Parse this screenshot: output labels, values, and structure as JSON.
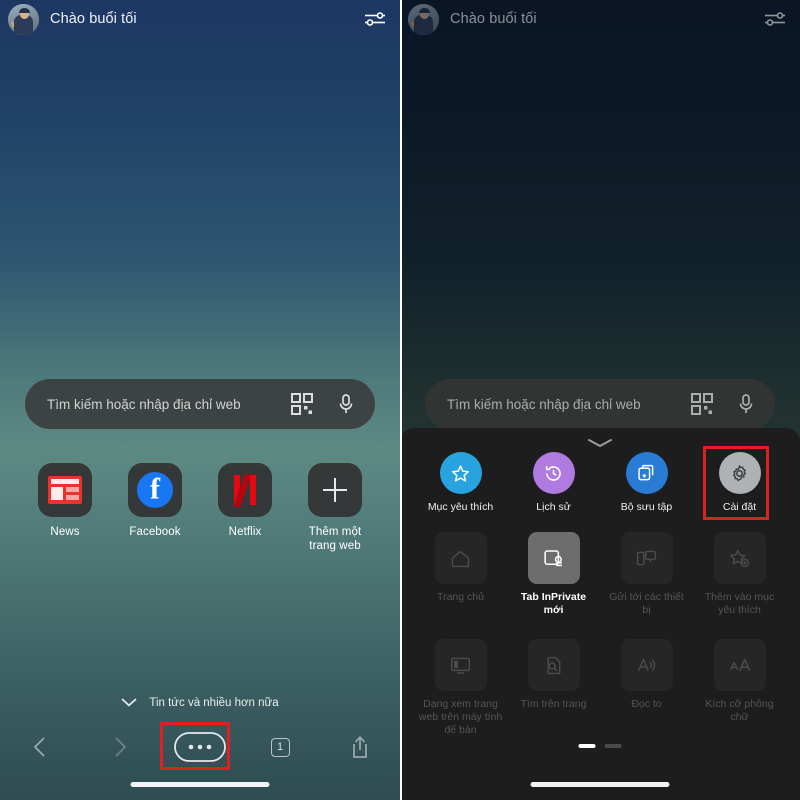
{
  "meta": {
    "app": "Microsoft Edge mobile browser",
    "language": "vi",
    "accent_highlight": "#e02020",
    "sheet_bg": "#1d1d1d"
  },
  "left_phone": {
    "header": {
      "avatar_name": "user-avatar",
      "greeting": "Chào buổi tối",
      "settings_icon": "sliders-icon"
    },
    "search": {
      "placeholder": "Tìm kiếm hoặc nhập địa chỉ web",
      "qr_icon": "qr-code-icon",
      "mic_icon": "microphone-icon"
    },
    "shortcuts": [
      {
        "label": "News",
        "icon": "news-icon"
      },
      {
        "label": "Facebook",
        "icon": "facebook-icon"
      },
      {
        "label": "Netflix",
        "icon": "netflix-icon"
      },
      {
        "label": "Thêm một trang web",
        "icon": "plus-icon"
      }
    ],
    "feed_toggle": {
      "icon": "chevron-down-icon",
      "label": "Tin tức và nhiều hơn nữa"
    },
    "bottom_nav": {
      "back_icon": "chevron-left-icon",
      "forward_icon": "chevron-right-icon",
      "more_icon": "ellipsis-icon",
      "tab_count": "1",
      "share_icon": "share-icon",
      "highlighted": "more-menu-button"
    }
  },
  "right_phone": {
    "header": {
      "avatar_name": "user-avatar",
      "greeting": "Chào buổi tối",
      "settings_icon": "sliders-icon"
    },
    "search": {
      "placeholder": "Tìm kiếm hoặc nhập địa chỉ web",
      "qr_icon": "qr-code-icon",
      "mic_icon": "microphone-icon"
    },
    "menu_sheet": {
      "handle_icon": "chevron-down-handle-icon",
      "quick_row": [
        {
          "label": "Mục yêu thích",
          "icon": "star-icon",
          "color": "#29a3e0",
          "state": "enabled"
        },
        {
          "label": "Lịch sử",
          "icon": "history-icon",
          "color": "#b07be0",
          "state": "enabled"
        },
        {
          "label": "Bộ sưu tập",
          "icon": "collections-icon",
          "color": "#2a7bd4",
          "state": "enabled"
        },
        {
          "label": "Cài đặt",
          "icon": "gear-icon",
          "color": "#aeb2b4",
          "state": "highlighted"
        }
      ],
      "grid_rows": [
        [
          {
            "label": "Trang chủ",
            "icon": "home-icon",
            "state": "disabled"
          },
          {
            "label": "Tab InPrivate mới",
            "icon": "inprivate-tab-icon",
            "state": "active"
          },
          {
            "label": "Gửi tới các thiết bị",
            "icon": "send-to-devices-icon",
            "state": "disabled"
          },
          {
            "label": "Thêm vào mục yêu thích",
            "icon": "add-favorite-icon",
            "state": "disabled"
          }
        ],
        [
          {
            "label": "Dạng xem trang web trên máy tính để bàn",
            "icon": "desktop-site-icon",
            "state": "disabled"
          },
          {
            "label": "Tìm trên trang",
            "icon": "find-in-page-icon",
            "state": "disabled"
          },
          {
            "label": "Đọc to",
            "icon": "read-aloud-icon",
            "state": "disabled"
          },
          {
            "label": "Kích cỡ phông chữ",
            "icon": "font-size-icon",
            "state": "disabled"
          }
        ]
      ],
      "pager": {
        "pages": 2,
        "current": 1
      }
    }
  }
}
